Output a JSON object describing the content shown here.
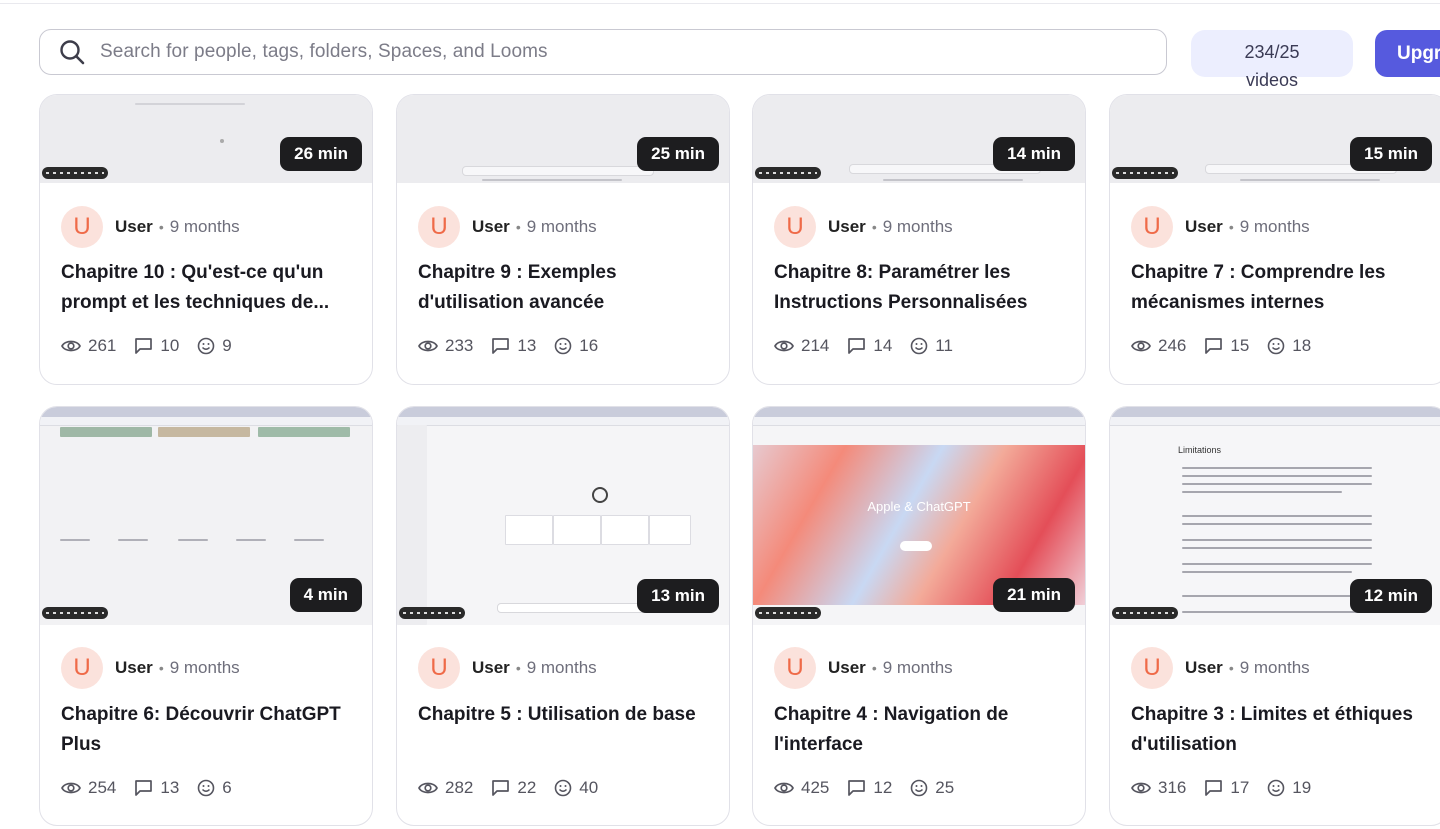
{
  "header": {
    "search_placeholder": "Search for people, tags, folders, Spaces, and Looms",
    "video_count_line1": "234/25",
    "video_count_line2": "videos",
    "upgrade_label": "Upgr"
  },
  "cards": [
    {
      "duration": "26 min",
      "avatar": "U",
      "author": "User",
      "age": "9 months",
      "title": "Chapitre 10 : Qu'est-ce qu'un prompt et les techniques de...",
      "views": "261",
      "comments": "10",
      "reactions": "9"
    },
    {
      "duration": "25 min",
      "avatar": "U",
      "author": "User",
      "age": "9 months",
      "title": "Chapitre 9 : Exemples d'utilisation avancée",
      "views": "233",
      "comments": "13",
      "reactions": "16"
    },
    {
      "duration": "14 min",
      "avatar": "U",
      "author": "User",
      "age": "9 months",
      "title": "Chapitre 8: Paramétrer les Instructions Personnalisées",
      "views": "214",
      "comments": "14",
      "reactions": "11"
    },
    {
      "duration": "15 min",
      "avatar": "U",
      "author": "User",
      "age": "9 months",
      "title": "Chapitre 7 : Comprendre les mécanismes internes",
      "views": "246",
      "comments": "15",
      "reactions": "18"
    },
    {
      "duration": "4 min",
      "avatar": "U",
      "author": "User",
      "age": "9 months",
      "title": "Chapitre 6: Découvrir ChatGPT Plus",
      "views": "254",
      "comments": "13",
      "reactions": "6"
    },
    {
      "duration": "13 min",
      "avatar": "U",
      "author": "User",
      "age": "9 months",
      "title": "Chapitre 5 : Utilisation de base",
      "views": "282",
      "comments": "22",
      "reactions": "40"
    },
    {
      "duration": "21 min",
      "avatar": "U",
      "author": "User",
      "age": "9 months",
      "title": "Chapitre 4 : Navigation de l'interface",
      "views": "425",
      "comments": "12",
      "reactions": "25",
      "thumb_text": "Apple & ChatGPT"
    },
    {
      "duration": "12 min",
      "avatar": "U",
      "author": "User",
      "age": "9 months",
      "title": "Chapitre 3 : Limites et éthiques d'utilisation",
      "views": "316",
      "comments": "17",
      "reactions": "19",
      "thumb_text": "Limitations"
    }
  ],
  "colors": {
    "accent": "#565ade",
    "avatar_bg": "#fbe2dc",
    "avatar_text": "#ef6a48",
    "badge_bg": "#1d1d1f"
  }
}
